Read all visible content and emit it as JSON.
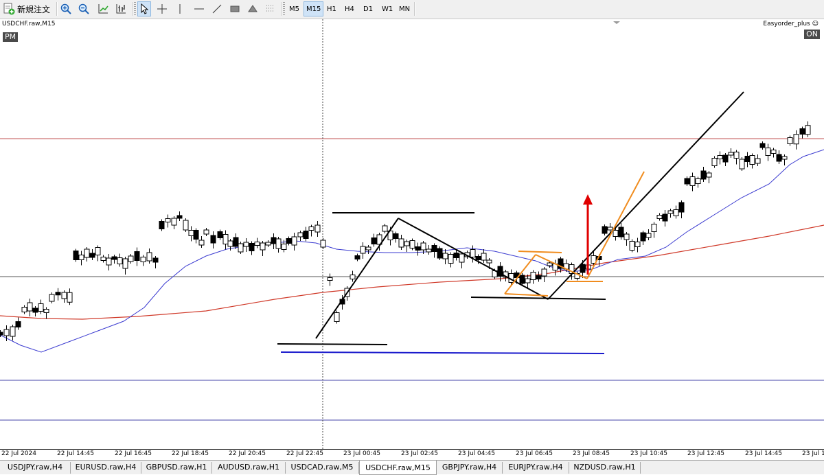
{
  "toolbar": {
    "new_order_label": "新規注文",
    "timeframes": [
      "M5",
      "M15",
      "H1",
      "H4",
      "D1",
      "W1",
      "MN"
    ],
    "active_timeframe": "M15"
  },
  "chart": {
    "symbol_label": "USDCHF.raw,M15",
    "session_badge": "PM",
    "ea_name": "Easyorder_plus ☺",
    "ea_status": "ON",
    "time_labels": [
      "22 Jul 2024",
      "22 Jul 14:45",
      "22 Jul 16:45",
      "22 Jul 18:45",
      "22 Jul 20:45",
      "22 Jul 22:45",
      "23 Jul 00:45",
      "23 Jul 02:45",
      "23 Jul 04:45",
      "23 Jul 06:45",
      "23 Jul 08:45",
      "23 Jul 10:45",
      "23 Jul 12:45",
      "23 Jul 14:45",
      "23 Jul 1"
    ],
    "colors": {
      "bull_candle": "#ffffff",
      "bear_candle": "#000000",
      "fast_ma": "#3a3ad0",
      "slow_ma": "#d03a2a",
      "resistance_line": "#c05050",
      "support_line": "#555555",
      "lower_lines": "#4444aa",
      "swing_lines": "#000000",
      "channel_lines": "#f08c1e",
      "signal_arrow": "#e00000",
      "bottom_line": "#1a1acc"
    }
  },
  "tabs": [
    "USDJPY.raw,H4",
    "EURUSD.raw,H4",
    "GBPUSD.raw,H1",
    "AUDUSD.raw,H1",
    "USDCAD.raw,M5",
    "USDCHF.raw,M15",
    "GBPJPY.raw,H4",
    "EURJPY.raw,H4",
    "NZDUSD.raw,H1"
  ],
  "active_tab": "USDCHF.raw,M15"
}
